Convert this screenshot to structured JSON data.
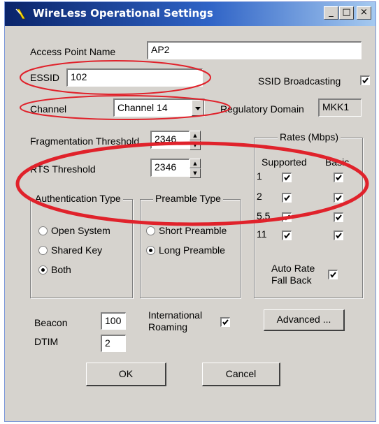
{
  "window": {
    "title": "WireLess Operational Settings",
    "minimize": "_",
    "maximize": "□",
    "close": "×"
  },
  "fields": {
    "ap_name_label": "Access Point Name",
    "ap_name_value": "AP2",
    "essid_label": "ESSID",
    "essid_value": "102",
    "ssid_broadcast_label": "SSID Broadcasting",
    "ssid_broadcast_checked": true,
    "channel_label": "Channel",
    "channel_value": "Channel 14",
    "regulatory_label": "Regulatory Domain",
    "regulatory_value": "MKK1",
    "frag_label": "Fragmentation Threshold",
    "frag_value": "2346",
    "rts_label": "RTS Threshold",
    "rts_value": "2346"
  },
  "authentication": {
    "title": "Authentication Type",
    "options": [
      {
        "label": "Open System",
        "selected": false
      },
      {
        "label": "Shared Key",
        "selected": false
      },
      {
        "label": "Both",
        "selected": true
      }
    ]
  },
  "preamble": {
    "title": "Preamble Type",
    "options": [
      {
        "label": "Short Preamble",
        "selected": false
      },
      {
        "label": "Long Preamble",
        "selected": true
      }
    ]
  },
  "rates": {
    "title": "Rates (Mbps)",
    "supported_header": "Supported",
    "basic_header": "Basic",
    "rows": [
      {
        "rate": "1",
        "supported": true,
        "basic": true
      },
      {
        "rate": "2",
        "supported": true,
        "basic": true
      },
      {
        "rate": "5.5",
        "supported": true,
        "basic": true
      },
      {
        "rate": "11",
        "supported": true,
        "basic": true
      }
    ],
    "auto_fallback_label_1": "Auto Rate",
    "auto_fallback_label_2": "Fall Back",
    "auto_fallback_checked": true
  },
  "bottom": {
    "beacon_label": "Beacon",
    "beacon_value": "100",
    "dtim_label": "DTIM",
    "dtim_value": "2",
    "roaming_label_1": "International",
    "roaming_label_2": "Roaming",
    "roaming_checked": true,
    "advanced_label": "Advanced ...",
    "ok_label": "OK",
    "cancel_label": "Cancel"
  },
  "colors": {
    "annotation": "#e0222b",
    "titlebar_start": "#0a246a",
    "titlebar_end": "#a6caf0",
    "dialog_bg": "#d6d3ce"
  }
}
